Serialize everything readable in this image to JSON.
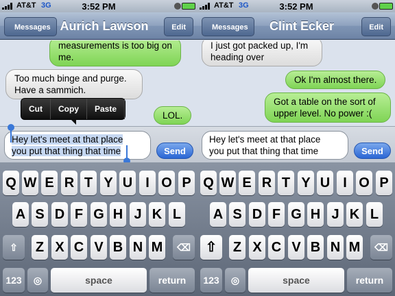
{
  "status": {
    "carrier": "AT&T",
    "network": "3G",
    "time": "3:52 PM"
  },
  "left": {
    "nav": {
      "back": "Messages",
      "title": "Aurich Lawson",
      "edit": "Edit"
    },
    "messages": [
      {
        "text": "measurements is too big on me.",
        "side": "right"
      },
      {
        "text": "Too much binge and purge. Have a sammich.",
        "side": "left"
      },
      {
        "text": "LOL.",
        "side": "right"
      }
    ],
    "popup": {
      "cut": "Cut",
      "copy": "Copy",
      "paste": "Paste"
    },
    "input": {
      "line1": "Hey let's meet at that place",
      "line2": "you put that thing that time"
    },
    "send": "Send"
  },
  "right": {
    "nav": {
      "back": "Messages",
      "title": "Clint Ecker",
      "edit": "Edit"
    },
    "messages": [
      {
        "text": "I just got packed up, I'm heading over",
        "side": "left"
      },
      {
        "text": "Ok I'm almost there.",
        "side": "right"
      },
      {
        "text": "Got a table on the sort of upper level. No power :(",
        "side": "right"
      }
    ],
    "input": {
      "line1": "Hey let's meet at that place",
      "line2": "you put that thing that time"
    },
    "send": "Send"
  },
  "keyboard": {
    "row1": [
      "Q",
      "W",
      "E",
      "R",
      "T",
      "Y",
      "U",
      "I",
      "O",
      "P"
    ],
    "row2": [
      "A",
      "S",
      "D",
      "F",
      "G",
      "H",
      "J",
      "K",
      "L"
    ],
    "row3": [
      "Z",
      "X",
      "C",
      "V",
      "B",
      "N",
      "M"
    ],
    "numbers": "123",
    "space": "space",
    "return": "return"
  }
}
